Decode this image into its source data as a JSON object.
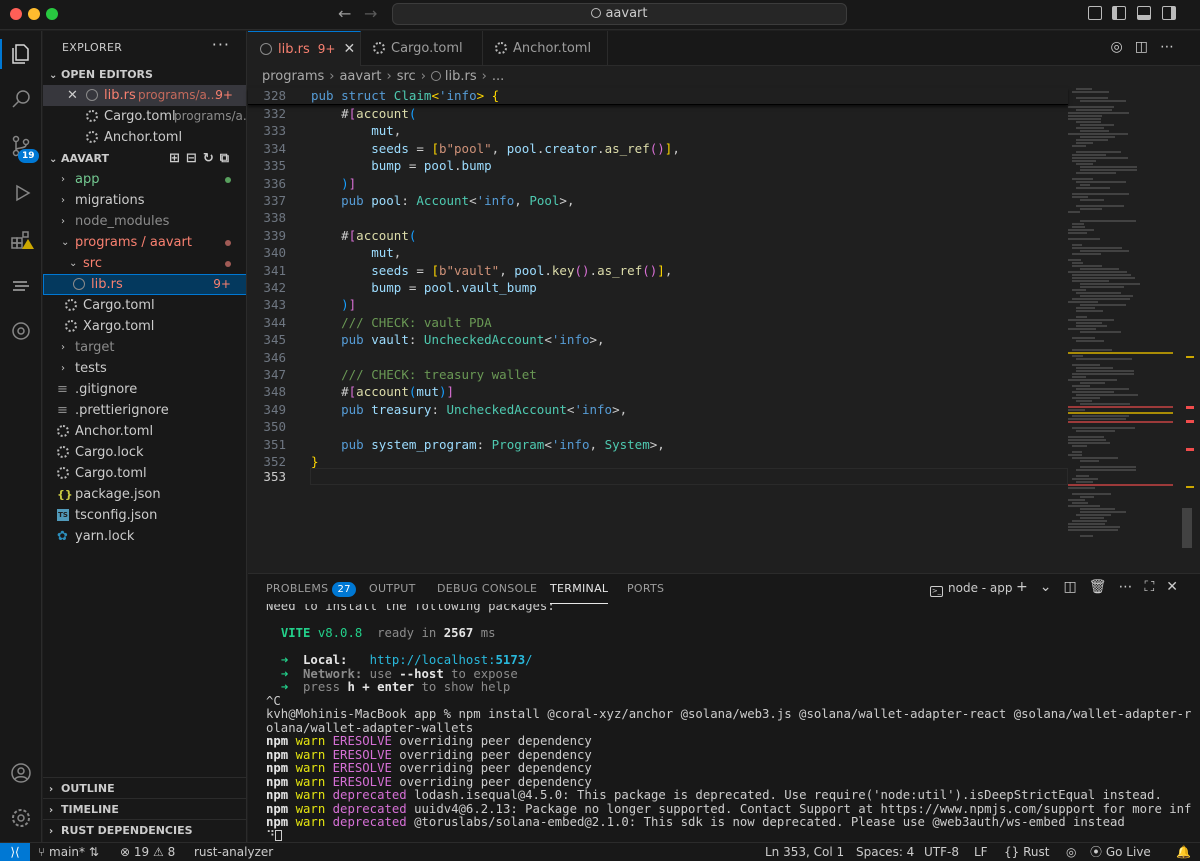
{
  "titlebar": {
    "search_text": "aavart"
  },
  "activity": {
    "scm_badge": "19"
  },
  "sidebar": {
    "title": "EXPLORER",
    "open_editors_label": "OPEN EDITORS",
    "open_editors": [
      {
        "name": "lib.rs",
        "path": "programs/a...",
        "badge": "9+"
      },
      {
        "name": "Cargo.toml",
        "path": "programs/a..."
      },
      {
        "name": "Anchor.toml",
        "path": ""
      }
    ],
    "root_label": "AAVART",
    "tree": [
      {
        "name": "app"
      },
      {
        "name": "migrations"
      },
      {
        "name": "node_modules"
      },
      {
        "name": "programs / aavart"
      },
      {
        "name": "src"
      },
      {
        "name": "lib.rs",
        "badge": "9+"
      },
      {
        "name": "Cargo.toml"
      },
      {
        "name": "Xargo.toml"
      },
      {
        "name": "target"
      },
      {
        "name": "tests"
      },
      {
        "name": ".gitignore"
      },
      {
        "name": ".prettierignore"
      },
      {
        "name": "Anchor.toml"
      },
      {
        "name": "Cargo.lock"
      },
      {
        "name": "Cargo.toml"
      },
      {
        "name": "package.json"
      },
      {
        "name": "tsconfig.json"
      },
      {
        "name": "yarn.lock"
      }
    ],
    "outline_label": "OUTLINE",
    "timeline_label": "TIMELINE",
    "rust_deps_label": "RUST DEPENDENCIES"
  },
  "tabs": [
    {
      "label": "lib.rs",
      "badge": "9+"
    },
    {
      "label": "Cargo.toml"
    },
    {
      "label": "Anchor.toml"
    }
  ],
  "breadcrumb": [
    "programs",
    "aavart",
    "src",
    "lib.rs",
    "..."
  ],
  "editor": {
    "sticky_line_no": "328",
    "line_numbers": [
      "332",
      "333",
      "334",
      "335",
      "336",
      "337",
      "338",
      "339",
      "340",
      "341",
      "342",
      "343",
      "344",
      "345",
      "346",
      "347",
      "348",
      "349",
      "350",
      "351",
      "352",
      "353"
    ]
  },
  "panel": {
    "tabs": [
      "PROBLEMS",
      "OUTPUT",
      "DEBUG CONSOLE",
      "TERMINAL",
      "PORTS"
    ],
    "problems_count": "27",
    "terminal_name": "node - app",
    "lines": {
      "l0": "Need to install the following packages:",
      "vite": "VITE",
      "vite_ver": " v8.0.8",
      "ready": "  ready in ",
      "ready_ms": "2567",
      "ms": " ms",
      "local_label": "Local:",
      "local_url_a": "http://localhost:",
      "local_url_b": "5173",
      "local_url_c": "/",
      "network_label": "Network:",
      "network_a": " use ",
      "network_b": "--host",
      "network_c": " to expose",
      "help_a": "press ",
      "help_b": "h + enter",
      "help_c": " to show help",
      "ctrl_c": "^C",
      "prompt1": "kvh@Mohinis-MacBook app % npm install @coral-xyz/anchor @solana/web3.js @solana/wallet-adapter-react @solana/wallet-adapter-react-ui @s",
      "prompt2": "olana/wallet-adapter-wallets",
      "npm": "npm",
      "warn": "warn",
      "eresolve": "ERESOLVE",
      "override": " overriding peer dependency",
      "deprecated": "deprecated",
      "dep1": " lodash.isequal@4.5.0: This package is deprecated. Use require('node:util').isDeepStrictEqual instead.",
      "dep2": " uuidv4@6.2.13: Package no longer supported. Contact Support at https://www.npmjs.com/support for more info.",
      "dep3": " @toruslabs/solana-embed@2.1.0: This sdk is now deprecated. Please use @web3auth/ws-embed instead",
      "spinner": "⠙"
    }
  },
  "statusbar": {
    "branch": "main*",
    "errors": "19",
    "warnings": "8",
    "analyzer": "rust-analyzer",
    "position": "Ln 353, Col 1",
    "spaces": "Spaces: 4",
    "encoding": "UTF-8",
    "eol": "LF",
    "language": "Rust",
    "golive": "Go Live"
  }
}
